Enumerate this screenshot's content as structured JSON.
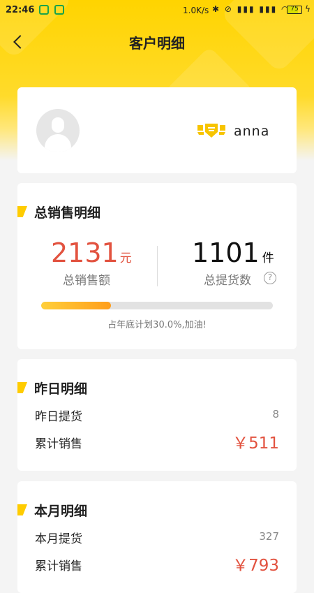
{
  "status_bar": {
    "time": "22:46",
    "speed": "1.0K/s",
    "battery": "75"
  },
  "nav": {
    "title": "客户明细"
  },
  "profile": {
    "username": "anna"
  },
  "sales_summary": {
    "title": "总销售明细",
    "total_amount": "2131",
    "amount_unit": "元",
    "amount_label": "总销售额",
    "total_count": "1101",
    "count_unit": "件",
    "count_label": "总提货数",
    "progress_percent": 30.0,
    "progress_text": "占年底计划30.0%,加油!"
  },
  "yesterday": {
    "title": "昨日明细",
    "pickup_label": "昨日提货",
    "pickup_value": "8",
    "sales_label": "累计销售",
    "sales_value": "￥511"
  },
  "month": {
    "title": "本月明细",
    "pickup_label": "本月提货",
    "pickup_value": "327",
    "sales_label": "累计销售",
    "sales_value": "￥793"
  },
  "colors": {
    "brand_yellow": "#ffd400",
    "money_red": "#e2523f",
    "progress_start": "#ffcf3a",
    "progress_end": "#ff9e1b"
  }
}
